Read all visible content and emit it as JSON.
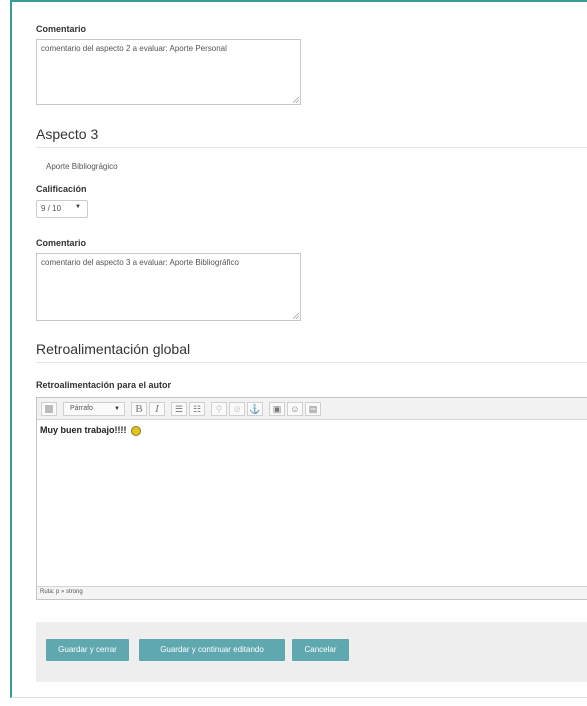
{
  "aspecto2": {
    "comentario_label": "Comentario",
    "comentario_value": "comentario del aspecto 2 a evaluar: Aporte Personal"
  },
  "aspecto3": {
    "title": "Aspecto 3",
    "description": "Aporte Bibliográgico",
    "calificacion_label": "Calificación",
    "calificacion_value": "9 / 10",
    "comentario_label": "Comentario",
    "comentario_value": "comentario del aspecto 3 a evaluar: Aporte Bibliográfico"
  },
  "retro": {
    "title": "Retroalimentación global",
    "field_label": "Retroalimentación para el autor",
    "format_value": "Párrafo",
    "content": "Muy buen trabajo!!!!",
    "path": "Ruta: p » strong"
  },
  "toolbar": {
    "bold": "B",
    "italic": "I"
  },
  "buttons": {
    "save_close": "Guardar y cerrar",
    "save_continue": "Guardar y continuar editando",
    "cancel": "Cancelar"
  },
  "colors": {
    "accent": "#3a9a94",
    "button": "#5fa8b0"
  }
}
